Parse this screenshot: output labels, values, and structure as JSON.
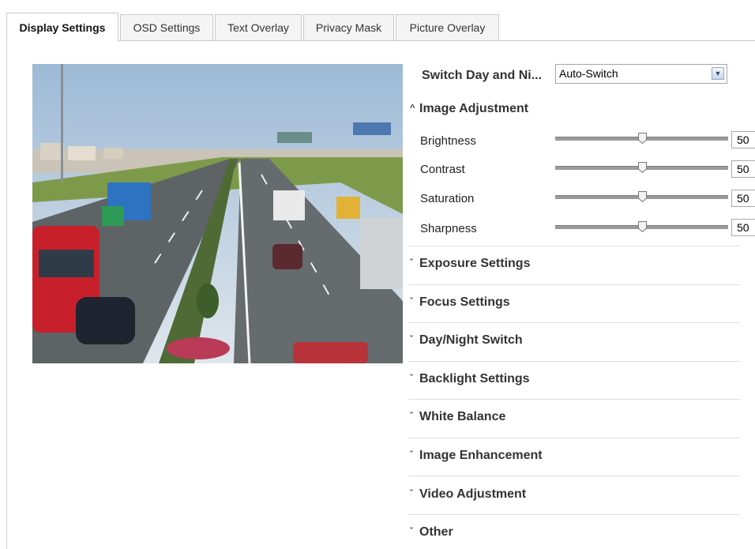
{
  "tabs": [
    {
      "label": "Display Settings",
      "active": true
    },
    {
      "label": "OSD Settings",
      "active": false
    },
    {
      "label": "Text Overlay",
      "active": false
    },
    {
      "label": "Privacy Mask",
      "active": false
    },
    {
      "label": "Picture Overlay",
      "active": false
    }
  ],
  "switch_day_night": {
    "label": "Switch Day and Ni...",
    "value": "Auto-Switch"
  },
  "image_adjustment": {
    "title": "Image Adjustment",
    "expanded_icon": "chevron-up-icon",
    "sliders": [
      {
        "label": "Brightness",
        "value": "50",
        "level": 0.5
      },
      {
        "label": "Contrast",
        "value": "50",
        "level": 0.5
      },
      {
        "label": "Saturation",
        "value": "50",
        "level": 0.5
      },
      {
        "label": "Sharpness",
        "value": "50",
        "level": 0.5
      }
    ]
  },
  "sections": [
    {
      "title": "Exposure Settings"
    },
    {
      "title": "Focus Settings"
    },
    {
      "title": "Day/Night Switch"
    },
    {
      "title": "Backlight Settings"
    },
    {
      "title": "White Balance"
    },
    {
      "title": "Image Enhancement"
    },
    {
      "title": "Video Adjustment"
    },
    {
      "title": "Other"
    }
  ],
  "colors": {
    "border": "#c9c9c9",
    "slider_track": "#9a9a9a",
    "sky": "#b9cde0",
    "road": "#5e6366"
  }
}
